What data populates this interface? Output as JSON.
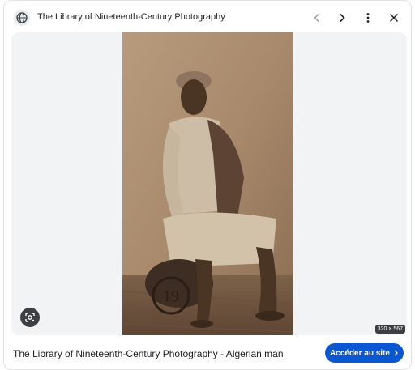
{
  "header": {
    "site_icon": "globe-icon",
    "title": "The Library of Nineteenth-Century Photography",
    "prev_icon": "chevron-left-icon",
    "next_icon": "chevron-right-icon",
    "more_icon": "more-vertical-icon",
    "close_icon": "close-icon"
  },
  "viewer": {
    "image_description_icon": "photo",
    "lens_icon": "lens-icon",
    "dimensions": "320 × 567",
    "watermark": "19"
  },
  "footer": {
    "caption": "The Library of Nineteenth-Century Photography - Algerian man",
    "visit_label": "Accéder au site",
    "visit_icon": "chevron-right-icon"
  },
  "colors": {
    "accent": "#0b57d0",
    "photo_tone": "#a8896b",
    "photo_dark": "#4a3423",
    "viewer_bg": "#f1f3f4"
  }
}
